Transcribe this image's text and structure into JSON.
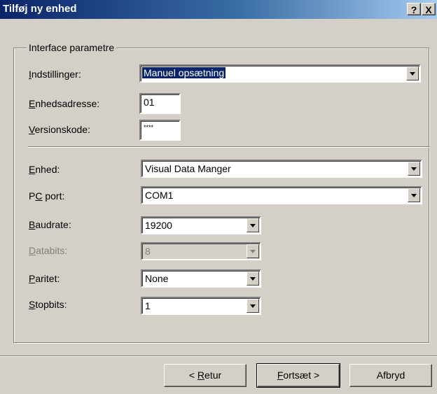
{
  "window": {
    "title": "Tilføj ny enhed",
    "help_label": "?",
    "close_label": "X"
  },
  "group": {
    "legend": "Interface parametre"
  },
  "fields": {
    "indstillinger": {
      "label_first": "I",
      "label_rest": "ndstillinger:",
      "value": "Manuel opsætning"
    },
    "enhedsadresse": {
      "label_first": "E",
      "label_rest": "nhedsadresse:",
      "value": "01"
    },
    "versionskode": {
      "label_first": "V",
      "label_rest": "ersionskode:",
      "value": "****"
    },
    "enhed": {
      "label_first": "E",
      "label_rest": "nhed:",
      "value": "Visual Data Manger"
    },
    "pcport": {
      "label_pre": "P",
      "label_first": "C",
      "label_rest": " port:",
      "value": "COM1"
    },
    "baudrate": {
      "label_first": "B",
      "label_rest": "audrate:",
      "value": "19200"
    },
    "databits": {
      "label_first": "D",
      "label_rest": "atabits:",
      "value": "8"
    },
    "paritet": {
      "label_first": "P",
      "label_rest": "aritet:",
      "value": "None"
    },
    "stopbits": {
      "label_first": "S",
      "label_rest": "topbits:",
      "value": "1"
    }
  },
  "buttons": {
    "back": {
      "pre": "< ",
      "first": "R",
      "rest": "etur"
    },
    "next": {
      "first": "F",
      "rest": "ortsæt >"
    },
    "cancel": {
      "label": "Afbryd"
    }
  }
}
